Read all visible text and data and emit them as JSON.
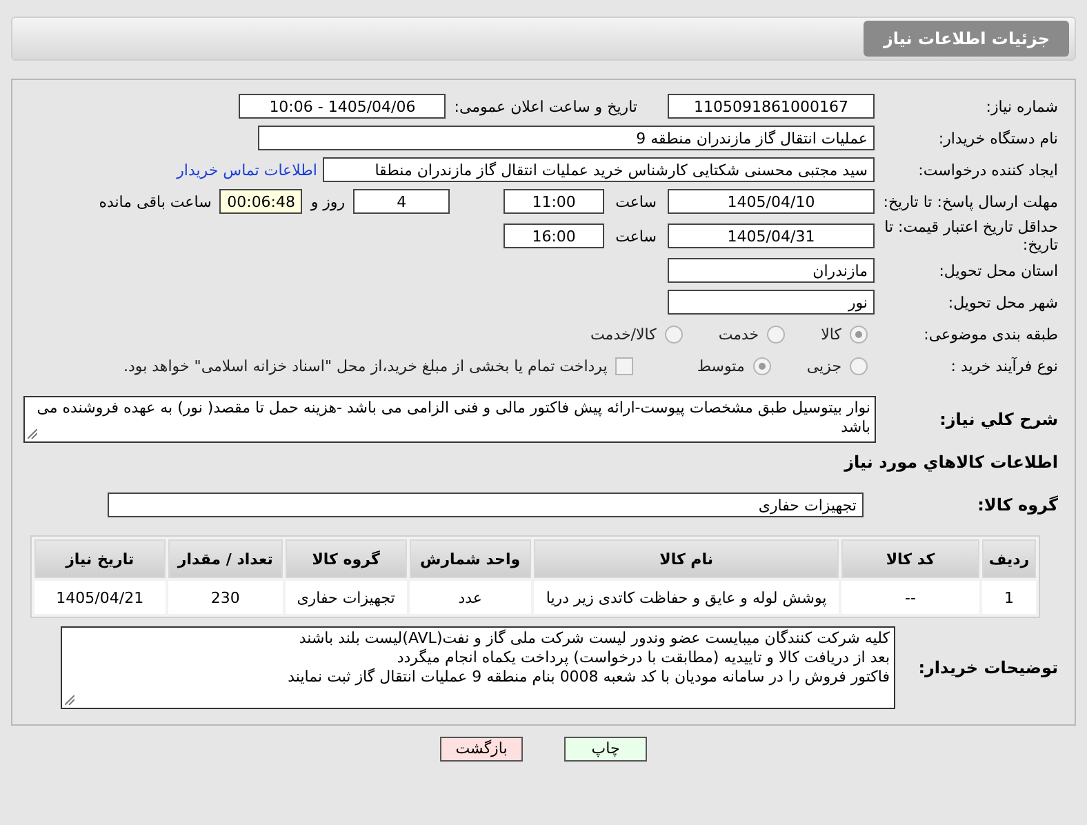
{
  "header": {
    "title": "جزئیات اطلاعات نیاز"
  },
  "need_number": {
    "label": "شماره نیاز:",
    "value": "1105091861000167"
  },
  "announce": {
    "label": "تاریخ و ساعت اعلان عمومی:",
    "value": "1405/04/06 - 10:06"
  },
  "buyer_org": {
    "label": "نام دستگاه خریدار:",
    "value": "عملیات انتقال گاز مازندران منطقه 9"
  },
  "requester": {
    "label": "ایجاد کننده درخواست:",
    "value": "سید مجتبی محسنی شکتایی کارشناس خرید عملیات انتقال گاز مازندران منطقا",
    "link": "اطلاعات تماس خریدار"
  },
  "deadline": {
    "label": "مهلت ارسال پاسخ: تا تاریخ:",
    "date": "1405/04/10",
    "time_label": "ساعت",
    "time": "11:00",
    "days": "4",
    "days_label": "روز و",
    "remaining": "00:06:48",
    "remaining_label": "ساعت باقی مانده"
  },
  "validity": {
    "label": "حداقل تاریخ اعتبار قیمت: تا تاریخ:",
    "date": "1405/04/31",
    "time_label": "ساعت",
    "time": "16:00"
  },
  "province": {
    "label": "استان محل تحویل:",
    "value": "مازندران"
  },
  "city": {
    "label": "شهر محل تحویل:",
    "value": "نور"
  },
  "category": {
    "label": "طبقه بندی موضوعی:",
    "options": [
      {
        "label": "کالا",
        "selected": true
      },
      {
        "label": "خدمت",
        "selected": false
      },
      {
        "label": "کالا/خدمت",
        "selected": false
      }
    ]
  },
  "purchase_process": {
    "label": "نوع فرآیند خرید :",
    "options": [
      {
        "label": "جزیی",
        "selected": false
      },
      {
        "label": "متوسط",
        "selected": true
      }
    ],
    "checkbox": {
      "label": "پرداخت تمام یا بخشی از مبلغ خرید،از محل \"اسناد خزانه اسلامی\" خواهد بود.",
      "checked": false
    }
  },
  "description": {
    "label": "شرح کلي نياز:",
    "value": "نوار بیتوسیل طبق مشخصات پیوست-ارائه پیش فاکتور مالی و فنی الزامی می باشد -هزینه حمل تا مقصد( نور) به عهده فروشنده می باشد"
  },
  "goods_title": "اطلاعات کالاهاي مورد نياز",
  "goods_group": {
    "label": "گروه کالا:",
    "value": "تجهیزات حفاری"
  },
  "table": {
    "columns": [
      "ردیف",
      "کد کالا",
      "نام کالا",
      "واحد شمارش",
      "گروه کالا",
      "تعداد / مقدار",
      "تاریخ نیاز"
    ],
    "rows": [
      [
        "1",
        "--",
        "پوشش لوله و عایق و حفاظت کاتدی زیر دریا",
        "عدد",
        "تجهیزات حفاری",
        "230",
        "1405/04/21"
      ]
    ]
  },
  "buyer_notes": {
    "label": "توضیحات خریدار:",
    "lines": [
      "کلیه شرکت کنندگان میبایست عضو وندور لیست شرکت ملی گاز و نفت(AVL)لیست بلند باشند",
      "بعد از دریافت کالا و تاییدیه (مطابقت با درخواست) پرداخت یکماه انجام میگردد",
      "فاکتور فروش را در سامانه مودیان با کد شعبه 0008 بنام منطقه 9 عملیات انتقال گاز ثبت نمایند"
    ]
  },
  "buttons": [
    {
      "label": "چاپ",
      "kind": "print"
    },
    {
      "label": "بازگشت",
      "kind": "back"
    }
  ]
}
